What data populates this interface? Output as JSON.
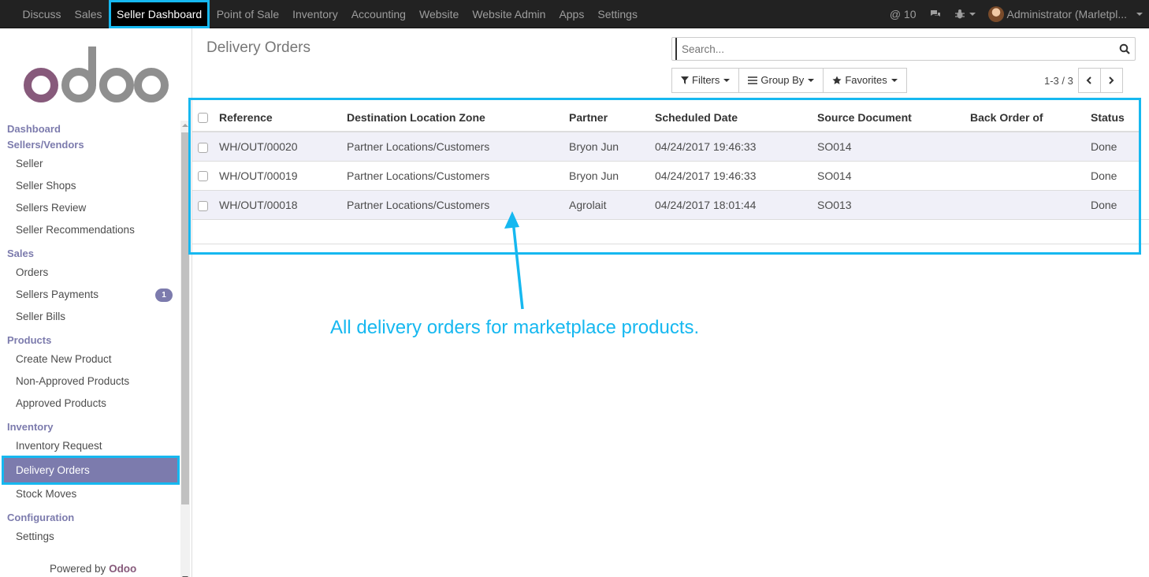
{
  "topnav": {
    "items": [
      "Discuss",
      "Sales",
      "Seller Dashboard",
      "Point of Sale",
      "Inventory",
      "Accounting",
      "Website",
      "Website Admin",
      "Apps",
      "Settings"
    ],
    "active": "Seller Dashboard",
    "mentions": "@ 10",
    "user": "Administrator (Marletpl..."
  },
  "sidebar": {
    "logo_text": "odoo",
    "sections": [
      {
        "title": "Dashboard",
        "items": []
      },
      {
        "title": "Sellers/Vendors",
        "items": [
          "Seller",
          "Seller Shops",
          "Sellers Review",
          "Seller Recommendations"
        ]
      },
      {
        "title": "Sales",
        "items": [
          "Orders",
          "Sellers Payments",
          "Seller Bills"
        ]
      },
      {
        "title": "Products",
        "items": [
          "Create New Product",
          "Non-Approved Products",
          "Approved Products"
        ]
      },
      {
        "title": "Inventory",
        "items": [
          "Inventory Request",
          "Delivery Orders",
          "Stock Moves"
        ]
      },
      {
        "title": "Configuration",
        "items": [
          "Settings"
        ]
      }
    ],
    "payments_badge": "1",
    "active_item": "Delivery Orders",
    "powered_by": "Powered by",
    "powered_brand": "Odoo"
  },
  "control": {
    "title": "Delivery Orders",
    "search_placeholder": "Search...",
    "filters": "Filters",
    "group_by": "Group By",
    "favorites": "Favorites",
    "pager": "1-3 / 3"
  },
  "table": {
    "columns": [
      "Reference",
      "Destination Location Zone",
      "Partner",
      "Scheduled Date",
      "Source Document",
      "Back Order of",
      "Status"
    ],
    "rows": [
      [
        "WH/OUT/00020",
        "Partner Locations/Customers",
        "Bryon Jun",
        "04/24/2017 19:46:33",
        "SO014",
        "",
        "Done"
      ],
      [
        "WH/OUT/00019",
        "Partner Locations/Customers",
        "Bryon Jun",
        "04/24/2017 19:46:33",
        "SO014",
        "",
        "Done"
      ],
      [
        "WH/OUT/00018",
        "Partner Locations/Customers",
        "Agrolait",
        "04/24/2017 18:01:44",
        "SO013",
        "",
        "Done"
      ]
    ]
  },
  "annotation": {
    "text": "All delivery orders for marketplace products."
  },
  "colors": {
    "accent": "#16b8f0",
    "brand": "#7c7bad",
    "navbar": "#222222"
  }
}
